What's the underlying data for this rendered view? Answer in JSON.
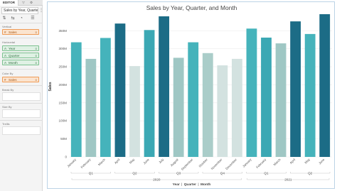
{
  "editor": {
    "tabs": [
      "EDITOR",
      "▽",
      "⚙"
    ],
    "chart_title_field": "Sales by Year, Quarter...",
    "sections": {
      "vertical": "Vertical",
      "horizontal": "Horizontal",
      "color_by": "Color By",
      "break_by": "Break By",
      "size_by": "Size By",
      "trellis": "Trellis"
    },
    "vertical_items": [
      "Sales"
    ],
    "horizontal_items": [
      "Year",
      "Quarter",
      "Month"
    ],
    "color_by_items": [
      "Sales"
    ],
    "icons": {
      "kebab": "⋮",
      "sort": "⇅",
      "swap": "⇆",
      "palette": "◔",
      "filter": "☰",
      "grip": "≡",
      "hash": "#",
      "tag": "A"
    }
  },
  "chart_data": {
    "type": "bar",
    "title": "Sales by Year, Quarter, and Month",
    "ylabel": "Sales",
    "yticks": [
      "0",
      "50M",
      "100M",
      "150M",
      "200M",
      "250M",
      "300M",
      "350M"
    ],
    "ylim": [
      0,
      390
    ],
    "grid": true,
    "categories": [
      "January",
      "February",
      "March",
      "April",
      "May",
      "June",
      "July",
      "August",
      "September",
      "October",
      "November",
      "December",
      "January",
      "February",
      "March",
      "April",
      "May",
      "June"
    ],
    "values": [
      318,
      272,
      330,
      370,
      252,
      352,
      390,
      275,
      318,
      288,
      254,
      272,
      356,
      331,
      315,
      376,
      341,
      396
    ],
    "colors": [
      "#45b3bb",
      "#9fc7c4",
      "#45b3bb",
      "#1c6c86",
      "#d3e2e0",
      "#3ba8b4",
      "#1c6c86",
      "#9fc7c4",
      "#45b3bb",
      "#aacdc9",
      "#d3e2e0",
      "#d3e2e0",
      "#45b3bb",
      "#3ba8b4",
      "#9fc7c4",
      "#1c6c86",
      "#45b3bb",
      "#1c6c86"
    ],
    "quarters": [
      "Q1",
      "Q2",
      "Q3",
      "Q4",
      "Q1",
      "Q2"
    ],
    "years": [
      "2020",
      "2021"
    ],
    "legend": [
      "Year",
      "Quarter",
      "Month"
    ]
  }
}
